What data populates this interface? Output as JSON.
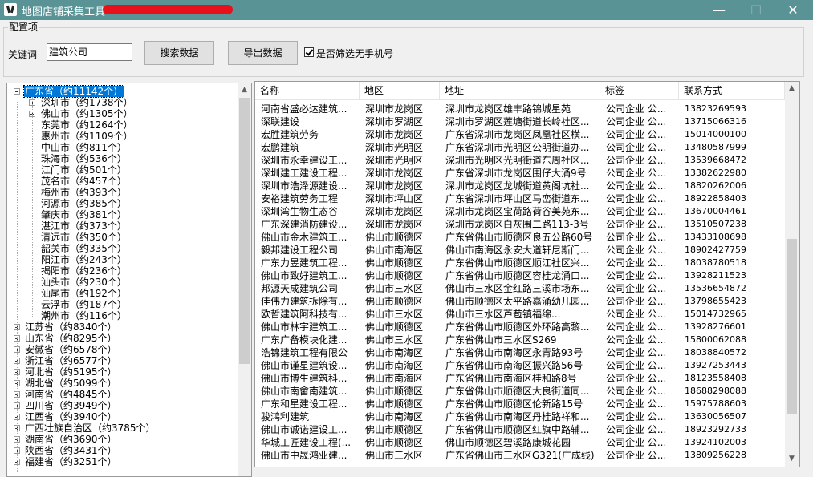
{
  "window": {
    "title": "地图店铺采集工具",
    "minimize": "—",
    "maximize": "☐",
    "close": "✕"
  },
  "config": {
    "group_label": "配置项",
    "keyword_label": "关键词",
    "keyword_value": "建筑公司",
    "search_button": "搜索数据",
    "export_button": "导出数据",
    "filter_checked": true,
    "filter_label": "是否筛选无手机号"
  },
  "tree": {
    "root": "广东省（约11142个）",
    "cities": [
      {
        "label": "深圳市（约1738个）",
        "expandable": true
      },
      {
        "label": "佛山市（约1305个）",
        "expandable": true
      },
      {
        "label": "东莞市（约1264个）",
        "expandable": false
      },
      {
        "label": "惠州市（约1109个）",
        "expandable": false
      },
      {
        "label": "中山市（约811个）",
        "expandable": false
      },
      {
        "label": "珠海市（约536个）",
        "expandable": false
      },
      {
        "label": "江门市（约501个）",
        "expandable": false
      },
      {
        "label": "茂名市（约457个）",
        "expandable": false
      },
      {
        "label": "梅州市（约393个）",
        "expandable": false
      },
      {
        "label": "河源市（约385个）",
        "expandable": false
      },
      {
        "label": "肇庆市（约381个）",
        "expandable": false
      },
      {
        "label": "湛江市（约373个）",
        "expandable": false
      },
      {
        "label": "清远市（约350个）",
        "expandable": false
      },
      {
        "label": "韶关市（约335个）",
        "expandable": false
      },
      {
        "label": "阳江市（约243个）",
        "expandable": false
      },
      {
        "label": "揭阳市（约236个）",
        "expandable": false
      },
      {
        "label": "汕头市（约230个）",
        "expandable": false
      },
      {
        "label": "汕尾市（约192个）",
        "expandable": false
      },
      {
        "label": "云浮市（约187个）",
        "expandable": false
      },
      {
        "label": "潮州市（约116个）",
        "expandable": false
      }
    ],
    "provinces": [
      "江苏省（约8340个）",
      "山东省（约8295个）",
      "安徽省（约6578个）",
      "浙江省（约6577个）",
      "河北省（约5195个）",
      "湖北省（约5099个）",
      "河南省（约4845个）",
      "四川省（约3949个）",
      "江西省（约3940个）",
      "广西壮族自治区（约3785个）",
      "湖南省（约3690个）",
      "陕西省（约3431个）",
      "福建省（约3251个）"
    ]
  },
  "table": {
    "headers": [
      "名称",
      "地区",
      "地址",
      "标签",
      "联系方式"
    ],
    "rows": [
      [
        "河南省盛必达建筑...",
        "深圳市龙岗区",
        "深圳市龙岗区雄丰路锦城星苑",
        "公司企业 公...",
        "13823269593"
      ],
      [
        "深联建设",
        "深圳市罗湖区",
        "深圳市罗湖区莲塘街道长岭社区...",
        "公司企业 公...",
        "13715066316"
      ],
      [
        "宏胜建筑劳务",
        "深圳市龙岗区",
        "广东省深圳市龙岗区凤凰社区横...",
        "公司企业 公...",
        "15014000100"
      ],
      [
        "宏鹏建筑",
        "深圳市光明区",
        "广东省深圳市光明区公明街道办...",
        "公司企业 公...",
        "13480587999"
      ],
      [
        "深圳市永幸建设工...",
        "深圳市光明区",
        "深圳市光明区光明街道东周社区...",
        "公司企业 公...",
        "13539668472"
      ],
      [
        "深圳建工建设工程...",
        "深圳市龙岗区",
        "广东省深圳市龙岗区围仔大涌9号",
        "公司企业 公...",
        "13382622980"
      ],
      [
        "深圳市浩泽源建设...",
        "深圳市龙岗区",
        "深圳市龙岗区龙城街道黄阁坑社...",
        "公司企业 公...",
        "18820262006"
      ],
      [
        "安裕建筑劳务工程",
        "深圳市坪山区",
        "广东省深圳市坪山区马峦街道东...",
        "公司企业 公...",
        "18922858403"
      ],
      [
        "深圳湾生物生态谷",
        "深圳市龙岗区",
        "深圳市龙岗区宝荷路荷谷美苑东...",
        "公司企业 公...",
        "13670004461"
      ],
      [
        "广东深建消防建设...",
        "深圳市龙岗区",
        "深圳市龙岗区白灰围二路113-3号",
        "公司企业 公...",
        "13510507238"
      ],
      [
        "佛山市金木建筑工...",
        "佛山市顺德区",
        "广东省佛山市顺德区良五公路60号",
        "公司企业 公...",
        "13433108698"
      ],
      [
        "毅邦建设工程公司",
        "佛山市南海区",
        "佛山市南海区永安大道轩尼斯门...",
        "公司企业 公...",
        "18902427759"
      ],
      [
        "广东力昱建筑工程...",
        "佛山市顺德区",
        "广东省佛山市顺德区顺江社区兴...",
        "公司企业 公...",
        "18038780518"
      ],
      [
        "佛山市致好建筑工...",
        "佛山市顺德区",
        "广东省佛山市顺德区容桂龙涌口...",
        "公司企业 公...",
        "13928211523"
      ],
      [
        "邦源天成建筑公司",
        "佛山市三水区",
        "佛山市三水区金红路三溪市场东...",
        "公司企业 公...",
        "13536654872"
      ],
      [
        "佳伟力建筑拆除有...",
        "佛山市顺德区",
        "佛山市顺德区太平路嘉涌幼儿园...",
        "公司企业 公...",
        "13798655423"
      ],
      [
        "欧哲建筑阿科技有...",
        "佛山市三水区",
        "佛山市三水区芦苞镇福绵...",
        "公司企业 公...",
        "15014732965"
      ],
      [
        "佛山市林宇建筑工...",
        "佛山市顺德区",
        "广东省佛山市顺德区外环路高黎...",
        "公司企业 公...",
        "13928276601"
      ],
      [
        "广东广备模块化建...",
        "佛山市三水区",
        "广东省佛山市三水区S269",
        "公司企业 公...",
        "15800062088"
      ],
      [
        "浩锦建筑工程有限公",
        "佛山市南海区",
        "广东省佛山市南海区永青路93号",
        "公司企业 公...",
        "18038840572"
      ],
      [
        "佛山市谨星建筑设...",
        "佛山市南海区",
        "广东省佛山市南海区振兴路56号",
        "公司企业 公...",
        "13927253443"
      ],
      [
        "佛山市博生建筑科...",
        "佛山市南海区",
        "广东省佛山市南海区桂和路8号",
        "公司企业 公...",
        "18123558408"
      ],
      [
        "佛山市南畲南建筑...",
        "佛山市顺德区",
        "广东省佛山市顺德区大良街道同...",
        "公司企业 公...",
        "18688298088"
      ],
      [
        "广东和星建设工程...",
        "佛山市顺德区",
        "广东省佛山市顺德区伦新路15号",
        "公司企业 公...",
        "15975788603"
      ],
      [
        "骏鸿利建筑",
        "佛山市南海区",
        "广东省佛山市南海区丹桂路祥和...",
        "公司企业 公...",
        "13630056507"
      ],
      [
        "佛山市诚诺建设工...",
        "佛山市顺德区",
        "广东省佛山市顺德区红旗中路辅...",
        "公司企业 公...",
        "18923292733"
      ],
      [
        "华城工匠建设工程(...",
        "佛山市顺德区",
        "佛山市顺德区碧溪路康城花园",
        "公司企业 公...",
        "13924102003"
      ],
      [
        "佛山市中晟鸿业建...",
        "佛山市三水区",
        "广东省佛山市三水区G321(广成线)",
        "公司企业 公...",
        "13809256228"
      ]
    ]
  }
}
